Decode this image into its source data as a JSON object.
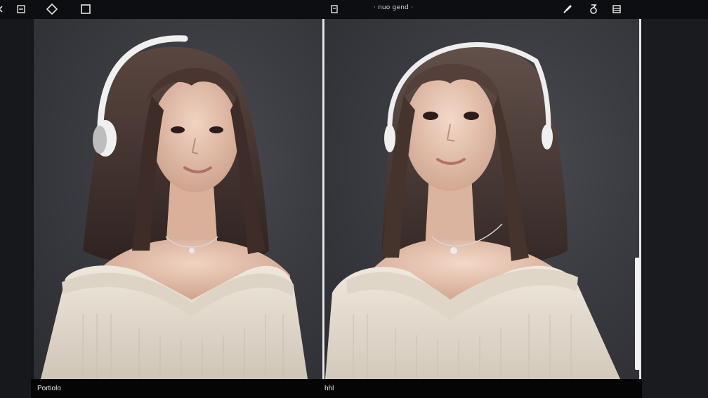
{
  "toolbar": {
    "title": "· nuo gend ·",
    "left_icons": [
      "menu-icon",
      "panel-icon",
      "diamond-icon",
      "square-icon"
    ],
    "center_icon": "document-icon",
    "right_icons": [
      "brush-icon",
      "rotate-icon",
      "layers-icon"
    ]
  },
  "panels": {
    "left": {
      "caption": "Portiolo"
    },
    "right": {
      "caption": "hhl"
    }
  },
  "colors": {
    "toolbar_bg": "#0d0e11",
    "canvas_bg": "#3b3c42",
    "divider": "#e8e8e8",
    "caption_bg": "#050506",
    "hair": "#4a3630",
    "skin": "#e9c7b4",
    "sweater": "#e6ddd0",
    "headphone": "#f0f0f0"
  }
}
